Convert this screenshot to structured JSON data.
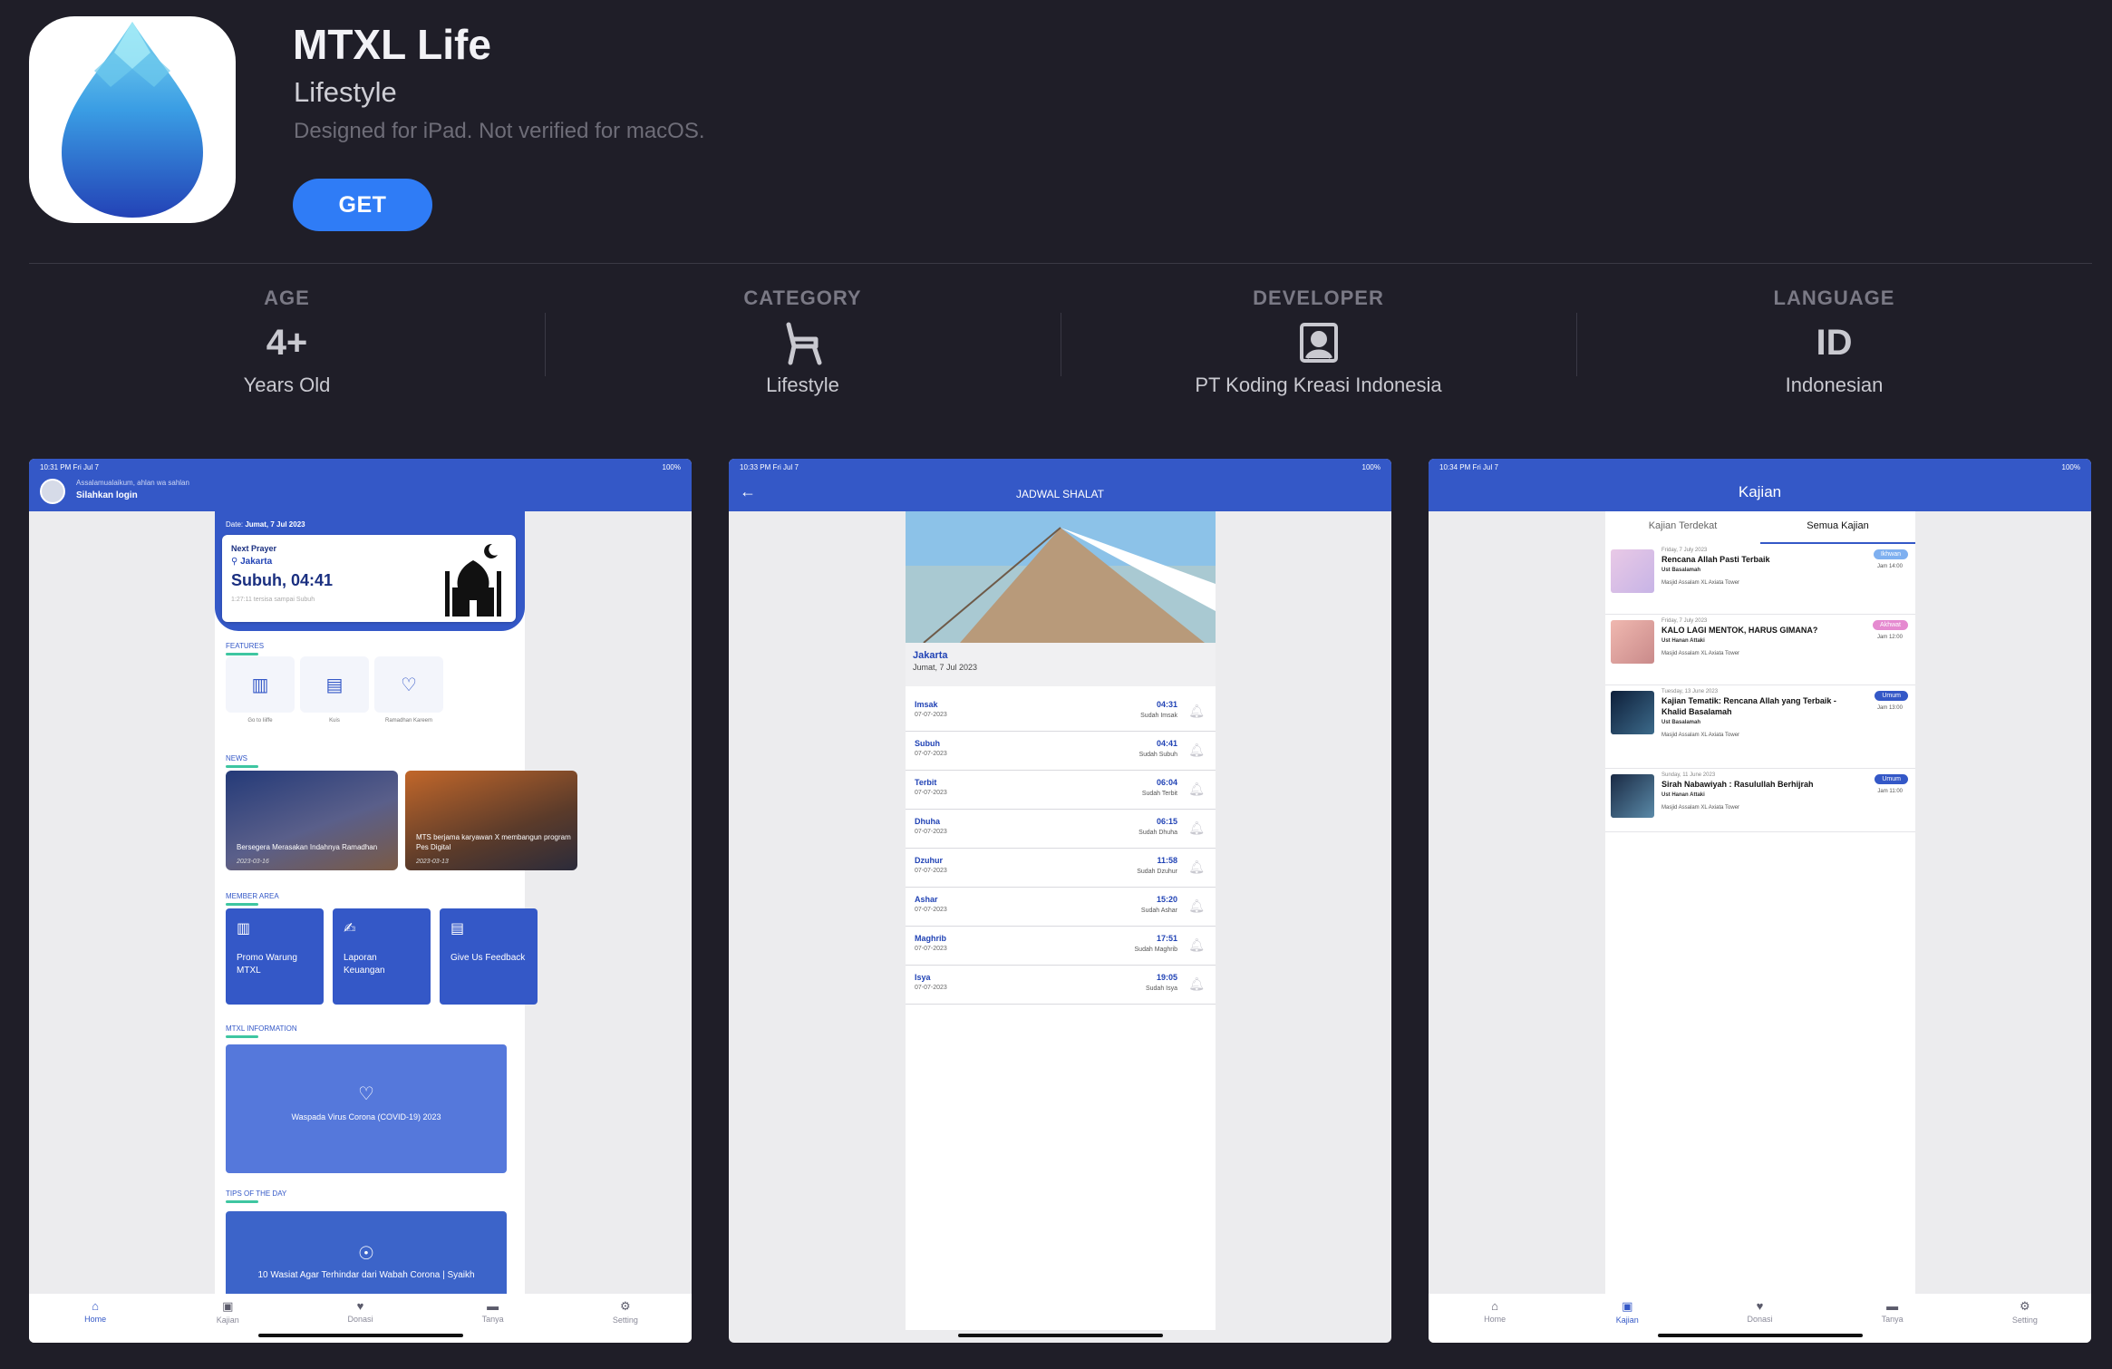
{
  "app": {
    "title": "MTXL Life",
    "category": "Lifestyle",
    "note": "Designed for iPad. Not verified for macOS.",
    "get_label": "GET"
  },
  "info": [
    {
      "label": "AGE",
      "value": "4+",
      "sub": "Years Old",
      "icon": null
    },
    {
      "label": "CATEGORY",
      "value": "",
      "sub": "Lifestyle",
      "icon": "chair-icon"
    },
    {
      "label": "DEVELOPER",
      "value": "",
      "sub": "PT Koding Kreasi Indonesia",
      "icon": "person-badge-icon"
    },
    {
      "label": "LANGUAGE",
      "value": "ID",
      "sub": "Indonesian",
      "icon": null
    }
  ],
  "screens": {
    "home": {
      "status_time": "10:31 PM   Fri Jul 7",
      "status_right": "100%",
      "greeting": "Assalamualaikum, ahlan wa sahlan",
      "login": "Silahkan login",
      "date_label": "Date: ",
      "date_value": "Jumat, 7 Jul 2023",
      "next_prayer_label": "Next Prayer",
      "location": "Jakarta",
      "next_prayer": "Subuh, 04:41",
      "remaining": "1:27:11 tersisa sampai Subuh",
      "features_title": "FEATURES",
      "features": [
        {
          "label": "Go to Iiiffe",
          "icon": "book-icon"
        },
        {
          "label": "Kuis",
          "icon": "quiz-icon"
        },
        {
          "label": "Ramadhan Kareem",
          "icon": "heart-icon"
        }
      ],
      "news_title": "NEWS",
      "news": [
        {
          "title": "Bersegera Merasakan Indahnya Ramadhan",
          "date": "2023-03-16"
        },
        {
          "title": "MTS berjama karyawan X membangun program Pes Digital",
          "date": "2023-03-13"
        }
      ],
      "member_title": "MEMBER AREA",
      "member": [
        {
          "label": "Promo Warung MTXL",
          "icon": "book-icon"
        },
        {
          "label": "Laporan Keuangan",
          "icon": "hand-icon"
        },
        {
          "label": "Give Us Feedback",
          "icon": "document-icon"
        }
      ],
      "info_title": "MTXL INFORMATION",
      "info_card": "Waspada Virus Corona (COVID-19) 2023",
      "tips_title": "TIPS OF THE DAY",
      "tips_card": "10 Wasiat Agar Terhindar dari Wabah Corona | Syaikh"
    },
    "jadwal": {
      "status_time": "10:33 PM   Fri Jul 7",
      "status_right": "100%",
      "title": "JADWAL SHALAT",
      "location": "Jakarta",
      "date": "Jumat, 7 Jul 2023",
      "prayers": [
        {
          "name": "Imsak",
          "date": "07-07-2023",
          "time": "04:31",
          "status": "Sudah Imsak"
        },
        {
          "name": "Subuh",
          "date": "07-07-2023",
          "time": "04:41",
          "status": "Sudah Subuh"
        },
        {
          "name": "Terbit",
          "date": "07-07-2023",
          "time": "06:04",
          "status": "Sudah Terbit"
        },
        {
          "name": "Dhuha",
          "date": "07-07-2023",
          "time": "06:15",
          "status": "Sudah Dhuha"
        },
        {
          "name": "Dzuhur",
          "date": "07-07-2023",
          "time": "11:58",
          "status": "Sudah Dzuhur"
        },
        {
          "name": "Ashar",
          "date": "07-07-2023",
          "time": "15:20",
          "status": "Sudah Ashar"
        },
        {
          "name": "Maghrib",
          "date": "07-07-2023",
          "time": "17:51",
          "status": "Sudah Maghrib"
        },
        {
          "name": "Isya",
          "date": "07-07-2023",
          "time": "19:05",
          "status": "Sudah Isya"
        }
      ]
    },
    "kajian": {
      "status_time": "10:34 PM   Fri Jul 7",
      "status_right": "100%",
      "title": "Kajian",
      "tabs": [
        "Kajian Terdekat",
        "Semua Kajian"
      ],
      "items": [
        {
          "date": "Friday, 7 July 2023",
          "title": "Rencana Allah  Pasti Terbaik",
          "ustadz": "Ust Basalamah",
          "place": "Masjid Assalam XL Axiata Tower",
          "badge": "Ikhwan",
          "badge_color": "#7fb0f0",
          "jam": "Jam 14:00"
        },
        {
          "date": "Friday, 7 July 2023",
          "title": "KALO LAGI MENTOK, HARUS GIMANA?",
          "ustadz": "Ust Hanan Attaki",
          "place": "Masjid Assalam XL Axiata Tower",
          "badge": "Akhwat",
          "badge_color": "#e58ad0",
          "jam": "Jam 12:00"
        },
        {
          "date": "Tuesday, 13 June 2023",
          "title": "Kajian Tematik: Rencana Allah yang Terbaik - Khalid Basalamah",
          "ustadz": "Ust Basalamah",
          "place": "Masjid Assalam XL Axiata Tower",
          "badge": "Umum",
          "badge_color": "#3458c7",
          "jam": "Jam 13:00"
        },
        {
          "date": "Sunday, 11 June 2023",
          "title": "Sirah Nabawiyah : Rasulullah Berhijrah",
          "ustadz": "Ust Hanan Attaki",
          "place": "Masjid Assalam XL Axiata Tower",
          "badge": "Umum",
          "badge_color": "#3458c7",
          "jam": "Jam 11:00"
        }
      ]
    },
    "tabbar": [
      {
        "label": "Home",
        "icon": "home-icon"
      },
      {
        "label": "Kajian",
        "icon": "kajian-icon"
      },
      {
        "label": "Donasi",
        "icon": "donate-icon"
      },
      {
        "label": "Tanya",
        "icon": "chat-icon"
      },
      {
        "label": "Setting",
        "icon": "gear-icon"
      }
    ]
  },
  "colors": {
    "background": "#1f1e28",
    "accent": "#2f7cf6",
    "app_blue": "#3458c7"
  }
}
